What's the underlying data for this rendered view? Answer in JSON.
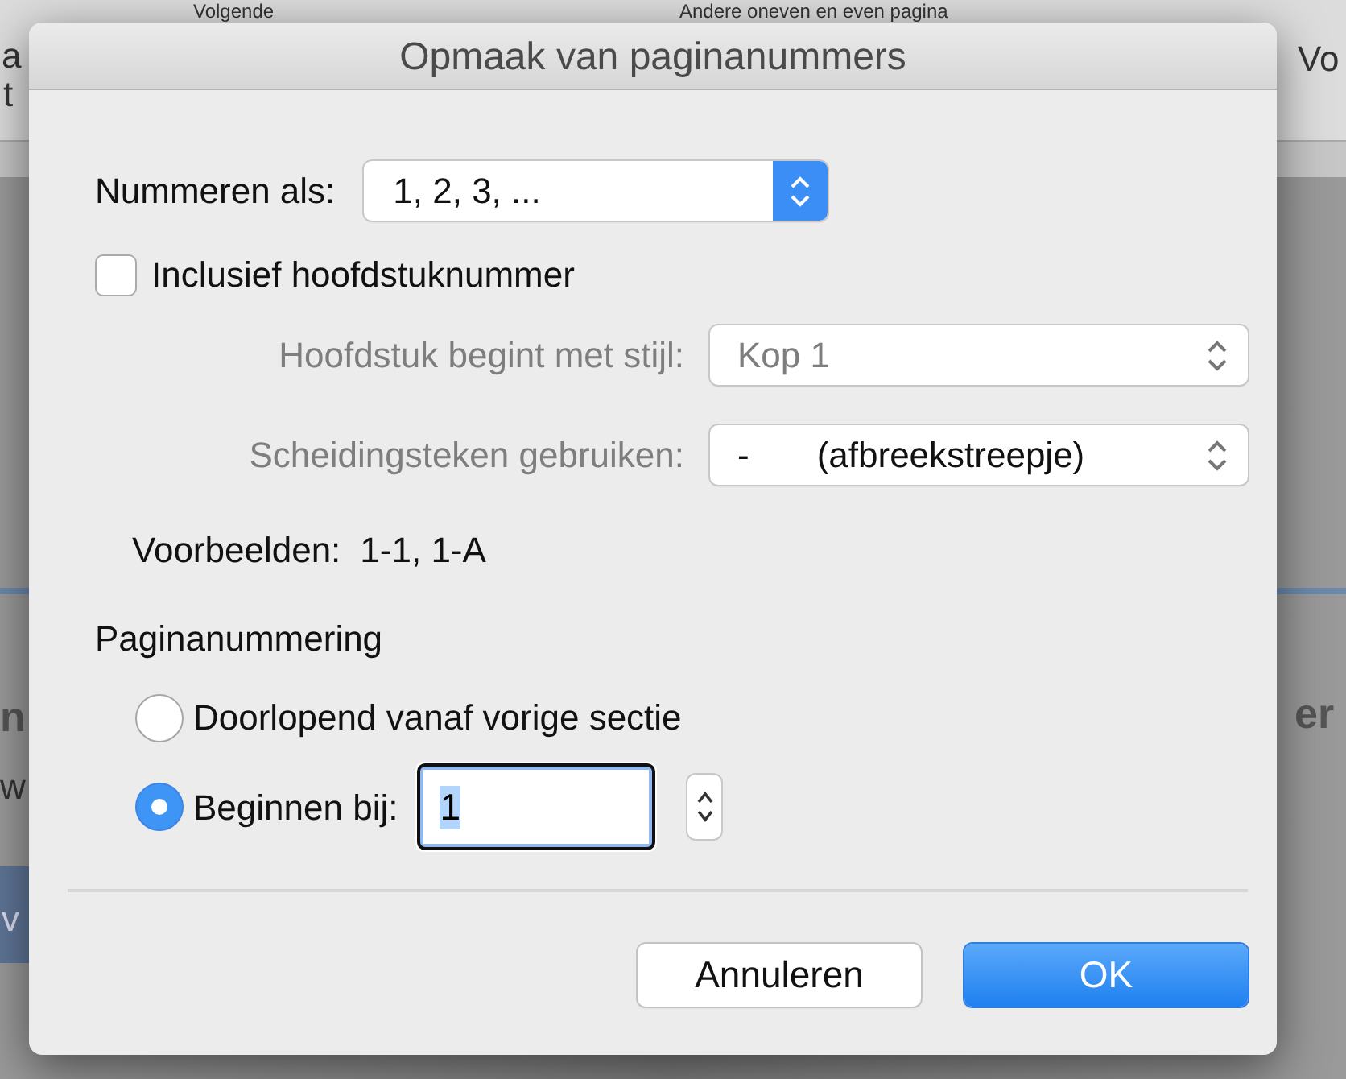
{
  "background": {
    "fragments": [
      {
        "text": "Volgende",
        "kind": "toolbar"
      },
      {
        "text": "Andere oneven en even pagina",
        "kind": "toolbar"
      },
      {
        "text": "a",
        "kind": "edge"
      },
      {
        "text": "t",
        "kind": "edge"
      },
      {
        "text": "Vo",
        "kind": "edge"
      },
      {
        "text": "n",
        "kind": "bold"
      },
      {
        "text": "w",
        "kind": "edge"
      },
      {
        "text": "v",
        "kind": "band"
      },
      {
        "text": "er",
        "kind": "bold"
      }
    ]
  },
  "dialog": {
    "title": "Opmaak van paginanummers",
    "number_format": {
      "label": "Nummeren als:",
      "value": "1, 2, 3, ..."
    },
    "include_chapter": {
      "label": "Inclusief hoofdstuknummer",
      "checked": false
    },
    "chapter_style": {
      "label": "Hoofdstuk begint met stijl:",
      "value": "Kop 1",
      "disabled": true,
      "value_disabled": true
    },
    "separator": {
      "label": "Scheidingsteken gebruiken:",
      "symbol": "-",
      "description": "(afbreekstreepje)",
      "disabled": true,
      "value_disabled": false
    },
    "examples": {
      "label": "Voorbeelden:",
      "value": "1-1, 1-A"
    },
    "page_numbering": {
      "heading": "Paginanummering",
      "options": [
        {
          "kind": "radio",
          "label": "Doorlopend vanaf vorige sectie",
          "selected": false
        },
        {
          "kind": "radio_input",
          "label": "Beginnen bij:",
          "selected": true,
          "value": "1"
        }
      ]
    },
    "buttons": [
      {
        "kind": "cancel",
        "label": "Annuleren"
      },
      {
        "kind": "default",
        "label": "OK"
      }
    ]
  }
}
